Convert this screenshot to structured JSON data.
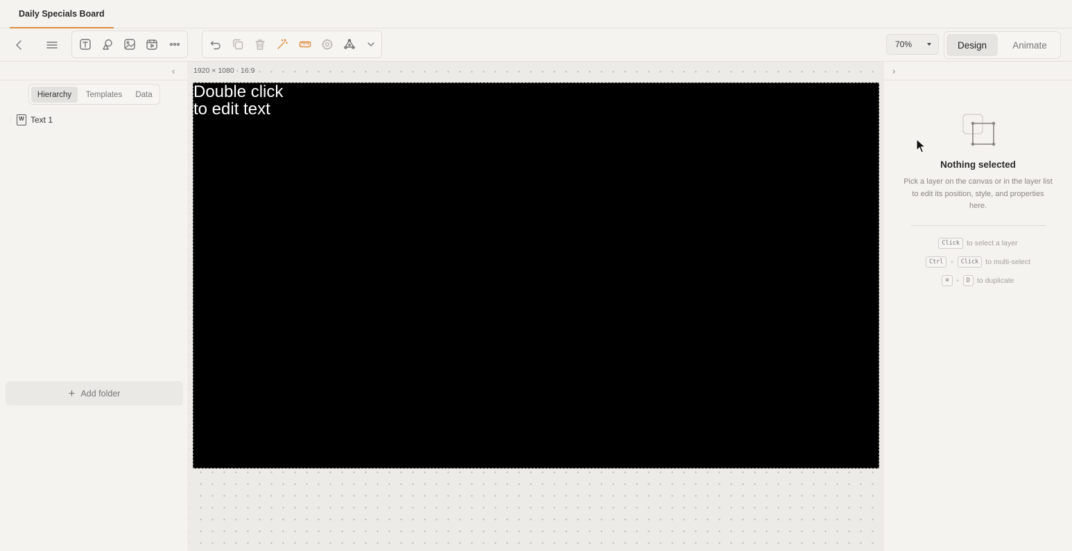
{
  "tab": {
    "title": "Daily Specials Board"
  },
  "toolbar": {
    "zoom": "70%",
    "modes": {
      "design": "Design",
      "animate": "Animate"
    },
    "accent_color": "#e08a3c"
  },
  "left_panel": {
    "tabs": [
      "Hierarchy",
      "Templates",
      "Data"
    ],
    "layers": [
      {
        "label": "Text 1",
        "icon": "text-layer-icon"
      }
    ],
    "add_folder": "Add folder"
  },
  "canvas": {
    "dimensions": "1920 × 1080",
    "ratio": "16:9",
    "placeholder_text": "Double click\nto edit text",
    "background": "#000000"
  },
  "inspector": {
    "title": "Nothing selected",
    "description": "Pick a layer on the canvas or in the layer list to edit its position, style, and properties here.",
    "hints": [
      {
        "keys": [
          "Click"
        ],
        "text": "to select a layer"
      },
      {
        "keys": [
          "Ctrl",
          "Click"
        ],
        "text": "to multi-select"
      },
      {
        "keys": [
          "⌘",
          "D"
        ],
        "text": "to duplicate"
      }
    ]
  }
}
